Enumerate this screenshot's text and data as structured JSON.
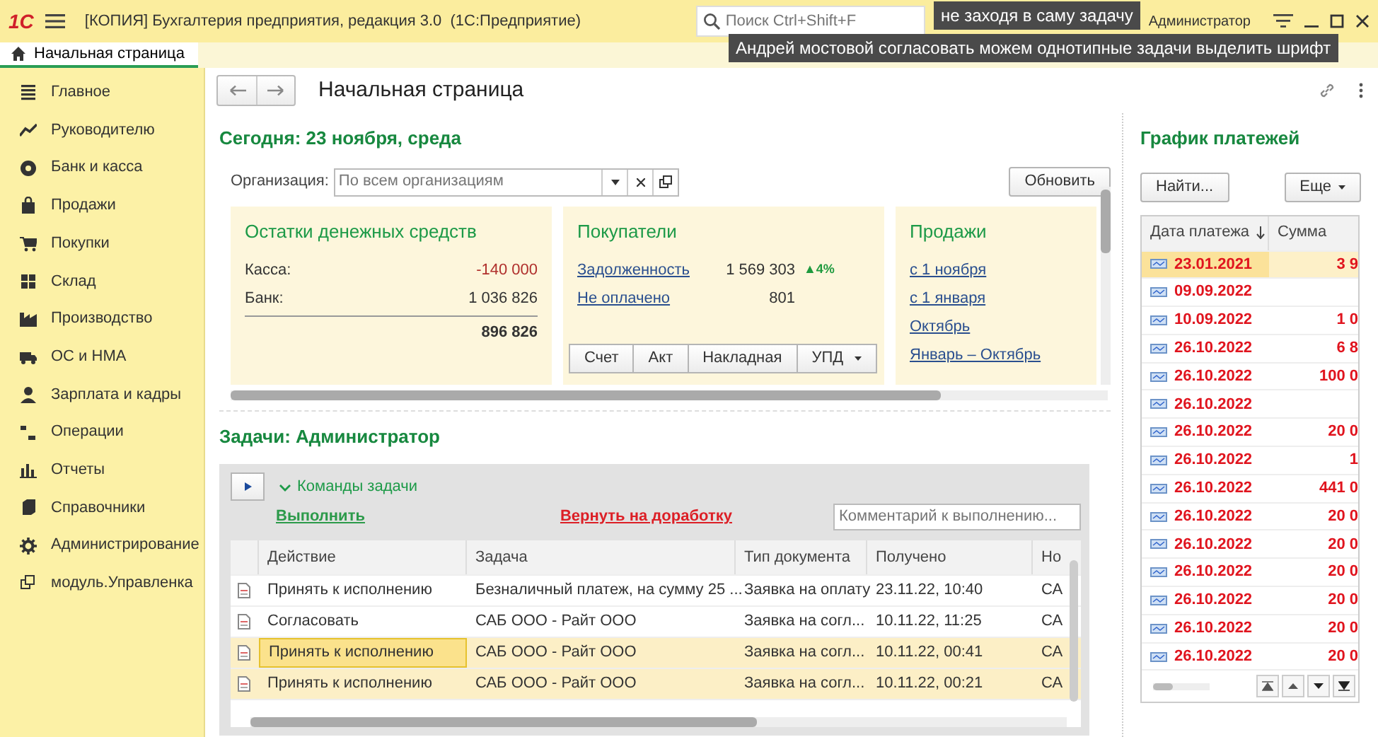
{
  "title_bar": {
    "logo": "1С",
    "title": "[КОПИЯ] Бухгалтерия предприятия, редакция 3.0  (1С:Предприятие)",
    "search": {
      "placeholder": "Поиск Ctrl+Shift+F"
    },
    "user": "Администратор"
  },
  "tooltips": [
    "не заходя в саму задачу",
    "Андрей мостовой согласовать можем однотипные задачи выделить шрифт"
  ],
  "tabs": [
    {
      "label": "Начальная страница",
      "selected": true
    }
  ],
  "sidebar": {
    "items": [
      "Главное",
      "Руководителю",
      "Банк и касса",
      "Продажи",
      "Покупки",
      "Склад",
      "Производство",
      "ОС и НМА",
      "Зарплата и кадры",
      "Операции",
      "Отчеты",
      "Справочники",
      "Администрирование",
      "модуль.Управленка"
    ]
  },
  "page": {
    "title": "Начальная страница"
  },
  "today": "Сегодня: 23 ноября, среда",
  "organization": {
    "label": "Организация:",
    "placeholder": "По всем организациям"
  },
  "refresh_button": "Обновить",
  "widgets": [
    {
      "kind": "balances",
      "title": "Остатки денежных средств",
      "rows": [
        {
          "label": "Касса:",
          "value": "-140 000",
          "negative": true
        },
        {
          "label": "Банк:",
          "value": "1 036 826",
          "negative": false
        }
      ],
      "total": "896 826"
    },
    {
      "kind": "customers",
      "title": "Покупатели",
      "rows": [
        {
          "label": "Задолженность",
          "value": "1 569 303",
          "trend": "▲4%"
        },
        {
          "label": "Не оплачено",
          "value": "801"
        }
      ],
      "buttons": [
        "Счет",
        "Акт",
        "Накладная",
        "УПД"
      ]
    },
    {
      "kind": "sales",
      "title": "Продажи",
      "links": [
        "с 1 ноября",
        "с 1 января",
        "Октябрь",
        "Январь – Октябрь"
      ]
    }
  ],
  "tasks": {
    "title": "Задачи: Администратор",
    "commands_label": "Команды задачи",
    "expanded": true,
    "execute_link": "Выполнить",
    "return_link": "Вернуть на доработку",
    "comment": {
      "placeholder": "Комментарий к выполнению..."
    },
    "columns": [
      "Действие",
      "Задача",
      "Тип документа",
      "Получено",
      "Но"
    ],
    "rows": [
      {
        "cells": [
          "Принять к исполнению",
          "Безналичный платеж,  на сумму 25 ...",
          "Заявка на оплату",
          "23.11.22, 10:40",
          "СА"
        ],
        "selected": false,
        "focused": false
      },
      {
        "cells": [
          "Согласовать",
          "САБ ООО - Райт ООО",
          "Заявка на согл...",
          "10.11.22, 11:25",
          "СА"
        ],
        "selected": false,
        "focused": false
      },
      {
        "cells": [
          "Принять к исполнению",
          "САБ ООО - Райт ООО",
          "Заявка на согл...",
          "10.11.22, 00:41",
          "СА"
        ],
        "selected": true,
        "focused": true
      },
      {
        "cells": [
          "Принять к исполнению",
          "САБ ООО - Райт ООО",
          "Заявка на согл...",
          "10.11.22, 00:21",
          "СА"
        ],
        "selected": true,
        "focused": false
      }
    ]
  },
  "payments": {
    "title": "График платежей",
    "find_button": "Найти...",
    "more_button": "Еще",
    "columns": [
      "Дата платежа",
      "Сумма"
    ],
    "rows": [
      {
        "date": "23.01.2021",
        "amount": "3 9",
        "overdue": true,
        "selected": true
      },
      {
        "date": "09.09.2022",
        "overdue": true,
        "selected": false
      },
      {
        "date": "10.09.2022",
        "amount": "1 0",
        "overdue": true,
        "selected": false
      },
      {
        "date": "26.10.2022",
        "amount": "6 8",
        "overdue": true,
        "selected": false
      },
      {
        "date": "26.10.2022",
        "amount": "100 0",
        "overdue": true,
        "selected": false
      },
      {
        "date": "26.10.2022",
        "overdue": true,
        "selected": false
      },
      {
        "date": "26.10.2022",
        "amount": "20 0",
        "overdue": true,
        "selected": false
      },
      {
        "date": "26.10.2022",
        "amount": "1",
        "overdue": true,
        "selected": false
      },
      {
        "date": "26.10.2022",
        "amount": "441 0",
        "overdue": true,
        "selected": false
      },
      {
        "date": "26.10.2022",
        "amount": "20 0",
        "overdue": true,
        "selected": false
      },
      {
        "date": "26.10.2022",
        "amount": "20 0",
        "overdue": true,
        "selected": false
      },
      {
        "date": "26.10.2022",
        "amount": "20 0",
        "overdue": true,
        "selected": false
      },
      {
        "date": "26.10.2022",
        "amount": "20 0",
        "overdue": true,
        "selected": false
      },
      {
        "date": "26.10.2022",
        "amount": "20 0",
        "overdue": true,
        "selected": false
      },
      {
        "date": "26.10.2022",
        "amount": "20 0",
        "overdue": true,
        "selected": false
      }
    ]
  }
}
